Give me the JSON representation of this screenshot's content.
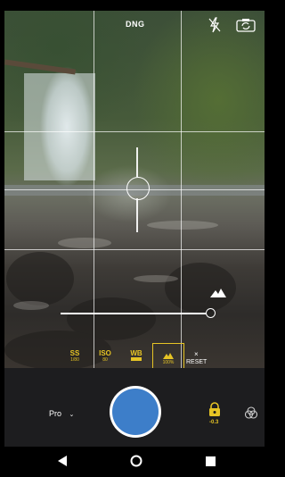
{
  "top_bar": {
    "format_badge": "DNG",
    "flash_icon": "flash-off-icon",
    "switch_camera_icon": "switch-camera-icon"
  },
  "viewfinder": {
    "grid": "3x4",
    "focus_icon": "focus-ring-icon",
    "exposure_icon": "mountain-icon"
  },
  "manual_controls": {
    "shutter_speed": {
      "label": "SS",
      "value": "1/80"
    },
    "iso": {
      "label": "ISO",
      "value": "80"
    },
    "white_balance": {
      "label": "WB",
      "value": ""
    },
    "focus": {
      "label": "",
      "value": "100%"
    },
    "reset_label": "RESET",
    "accent_color": "#e6c425"
  },
  "bottom_controls": {
    "mode_label": "Pro",
    "mode_chevron": "chevron-down-icon",
    "shutter_color": "#3d7ec9",
    "exposure_lock_icon": "lock-icon",
    "exposure_value": "-0.3",
    "filter_icon": "filter-icon"
  },
  "nav": {
    "back_icon": "back-icon",
    "home_icon": "home-icon",
    "recents_icon": "recents-icon"
  }
}
